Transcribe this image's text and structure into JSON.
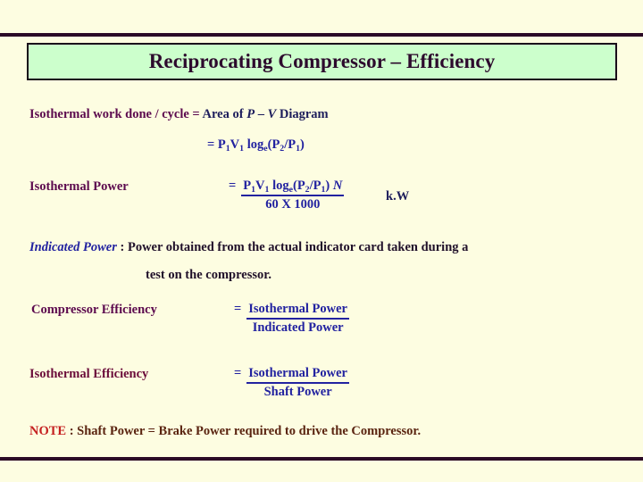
{
  "slide": {
    "title": "Reciprocating Compressor – Efficiency",
    "background_color": "#fdfde1",
    "title_box_color": "#ccffcc",
    "rule_color": "#2b0a26"
  },
  "content": {
    "isothermal_work": {
      "label": "Isothermal work done / cycle = ",
      "value": "Area of P – V Diagram",
      "equation_line2_eq": "= ",
      "equation_line2": "P1V1 loge(P2/P1)",
      "eq2_p1": "P",
      "eq2_sub1": "1",
      "eq2_v1": "V",
      "eq2_subv": "1",
      "eq2_log": "log",
      "eq2_logsub": "e",
      "eq2_open": "(",
      "eq2_p2": "P",
      "eq2_sub2": "2",
      "eq2_slash": "/",
      "eq2_p1b": "P",
      "eq2_sub1b": "1",
      "eq2_close": ")"
    },
    "isothermal_power": {
      "label": "Isothermal Power",
      "eq_sign": "=",
      "numerator": "P1V1 loge(P2/P1) N",
      "num_p1": "P",
      "num_s1": "1",
      "num_v1": "V",
      "num_sv": "1",
      "num_log": "log",
      "num_logsub": "e",
      "num_open": "(",
      "num_p2": "P",
      "num_s2": "2",
      "num_slash": "/",
      "num_p1b": "P",
      "num_s1b": "1",
      "num_close": ")",
      "num_n": "N",
      "denominator": "60 X 1000",
      "unit": "k.W"
    },
    "indicated_power": {
      "term": "Indicated Power",
      "separator": " : ",
      "definition_line1": "Power  obtained from the actual indicator card taken during a",
      "definition_line2": "test on the compressor."
    },
    "compressor_efficiency": {
      "label": "Compressor Efficiency",
      "eq_sign": "=",
      "numerator": "Isothermal Power",
      "denominator": "Indicated Power"
    },
    "isothermal_efficiency": {
      "label": "Isothermal Efficiency",
      "eq_sign": "=",
      "numerator": "Isothermal Power",
      "denominator": "Shaft Power"
    },
    "note": {
      "keyword": "NOTE",
      "text": " : Shaft Power = Brake Power required to drive the Compressor."
    }
  },
  "colors": {
    "purple": "#5c0a4e",
    "maroon": "#6b0b3a",
    "blue": "#2222a0",
    "navy": "#1d1d5c",
    "dark": "#20102a",
    "red": "#c52020",
    "brown": "#5a2410",
    "mint": "#ccffcc",
    "cream": "#fdfde1"
  }
}
